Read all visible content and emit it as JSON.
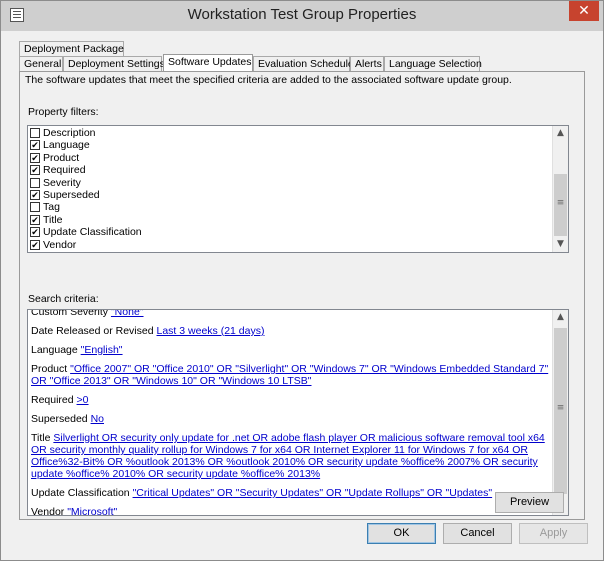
{
  "window": {
    "title": "Workstation Test Group Properties",
    "close_glyph": "✕"
  },
  "tabs_row1": [
    {
      "label": "Deployment Package"
    }
  ],
  "tabs_row2": [
    {
      "label": "General"
    },
    {
      "label": "Deployment Settings"
    },
    {
      "label": "Software Updates",
      "active": true
    },
    {
      "label": "Evaluation Schedule"
    },
    {
      "label": "Alerts"
    },
    {
      "label": "Language Selection"
    }
  ],
  "panel": {
    "description": "The software updates that meet the specified criteria are added to the associated software update group.",
    "property_filters_label": "Property filters:",
    "search_criteria_label": "Search criteria:"
  },
  "property_filters": [
    {
      "label": "Description",
      "checked": false
    },
    {
      "label": "Language",
      "checked": true
    },
    {
      "label": "Product",
      "checked": true
    },
    {
      "label": "Required",
      "checked": true
    },
    {
      "label": "Severity",
      "checked": false
    },
    {
      "label": "Superseded",
      "checked": true
    },
    {
      "label": "Tag",
      "checked": false
    },
    {
      "label": "Title",
      "checked": true
    },
    {
      "label": "Update Classification",
      "checked": true
    },
    {
      "label": "Vendor",
      "checked": true
    }
  ],
  "search_criteria": [
    {
      "name": "Custom Severity",
      "value": "\"None\""
    },
    {
      "name": "Date Released or Revised",
      "value": "Last 3 weeks (21 days)"
    },
    {
      "name": "Language",
      "value": "\"English\""
    },
    {
      "name": "Product",
      "value": "\"Office 2007\" OR \"Office 2010\" OR \"Silverlight\" OR \"Windows 7\" OR \"Windows Embedded Standard 7\" OR \"Office 2013\" OR \"Windows 10\" OR \"Windows 10 LTSB\""
    },
    {
      "name": "Required",
      "value": ">0"
    },
    {
      "name": "Superseded",
      "value": "No"
    },
    {
      "name": "Title",
      "value": "Silverlight OR security only update for .net OR adobe flash player OR malicious software removal tool x64 OR security monthly quality rollup for Windows 7 for x64 OR Internet Explorer 11 for Windows 7 for x64 OR Office%32-Bit% OR %outlook 2013% OR %outlook 2010% OR security update %office% 2007% OR security update %office% 2010% OR security update %office% 2013%"
    },
    {
      "name": "Update Classification",
      "value": "\"Critical Updates\" OR \"Security Updates\" OR \"Update Rollups\" OR \"Updates\""
    },
    {
      "name": "Vendor",
      "value": "\"Microsoft\""
    }
  ],
  "buttons": {
    "preview": "Preview",
    "ok": "OK",
    "cancel": "Cancel",
    "apply": "Apply"
  },
  "scroll_glyphs": {
    "up": "▲",
    "down": "▼",
    "grip": "≡"
  }
}
